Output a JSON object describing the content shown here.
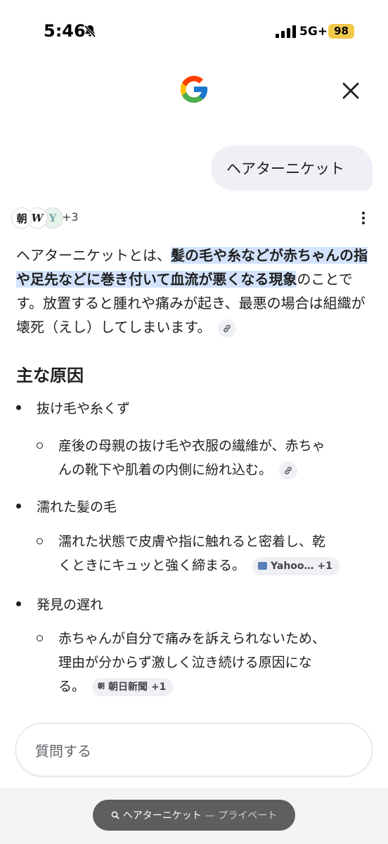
{
  "status_bar": {
    "time": "5:46",
    "network": "5G+",
    "battery": "98",
    "battery_color": "#f2c84b"
  },
  "header": {
    "logo": "google-g-logo",
    "close_icon": "close-icon"
  },
  "query": {
    "text": "ヘアターニケット"
  },
  "sources": {
    "icons": [
      "朝",
      "W",
      "Y"
    ],
    "more": "+3"
  },
  "answer": {
    "intro_pre": "ヘアターニケットとは、",
    "intro_highlight": "髪の毛や糸などが赤ちゃんの指や足先などに巻き付いて血流が悪くなる現象",
    "intro_post": "のことです。放置すると腫れや痛みが起き、最悪の場合は組織が壊死（えし）してしまいます。",
    "section_title": "主な原因",
    "causes": [
      {
        "title": "抜け毛や糸くず",
        "detail_line1": "産後の母親の抜け毛や衣服の繊維が、赤ちゃ",
        "detail_line2": "んの靴下や肌着の内側に紛れ込む。"
      },
      {
        "title": "濡れた髪の毛",
        "detail_line1": "濡れた状態で皮膚や指に触れると密着し、乾",
        "detail_line2": "くときにキュッと強く締まる。",
        "chip": "Yahoo… +1"
      },
      {
        "title": "発見の遅れ",
        "detail_line1": "赤ちゃんが自分で痛みを訴えられないため、",
        "detail_line2": "理由が分からず激しく泣き続ける原因にな",
        "detail_line3": "る。",
        "chip_icon": "朝",
        "chip": "朝日新聞 +1"
      }
    ]
  },
  "input": {
    "placeholder": "質問する"
  },
  "url_bar": {
    "query": "ヘアターニケット",
    "mode": "— プライベート"
  },
  "colors": {
    "highlight": "#d3e3fd",
    "chip_bg": "#eef0f5",
    "pill_bg": "#5e5e5e"
  }
}
